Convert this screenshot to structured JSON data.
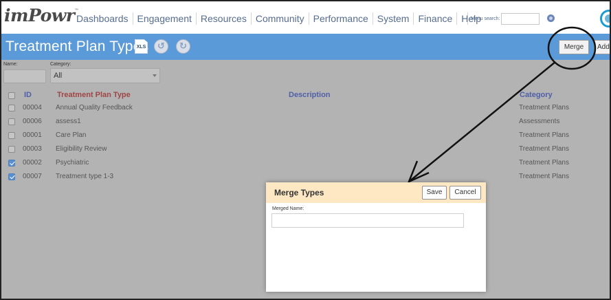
{
  "app": {
    "logo": "imPowr",
    "logo_mark": "™"
  },
  "nav": {
    "items": [
      "Dashboards",
      "Engagement",
      "Resources",
      "Community",
      "Performance",
      "System",
      "Finance",
      "Help"
    ],
    "menu_search_label": "Menu search:",
    "menu_search_value": ""
  },
  "header": {
    "title": "Treatment Plan Types",
    "xls_label": "XLS",
    "merge_label": "Merge",
    "add_label": "Add"
  },
  "filters": {
    "name_label": "Name:",
    "name_value": "",
    "category_label": "Category:",
    "category_value": "All"
  },
  "table": {
    "columns": {
      "id": "ID",
      "type": "Treatment Plan Type",
      "description": "Description",
      "category": "Category"
    },
    "rows": [
      {
        "id": "00004",
        "type": "Annual Quality Feedback",
        "description": "",
        "category": "Treatment Plans",
        "checked": false
      },
      {
        "id": "00006",
        "type": "assess1",
        "description": "",
        "category": "Assessments",
        "checked": false
      },
      {
        "id": "00001",
        "type": "Care Plan",
        "description": "",
        "category": "Treatment Plans",
        "checked": false
      },
      {
        "id": "00003",
        "type": "Eligibility Review",
        "description": "",
        "category": "Treatment Plans",
        "checked": false
      },
      {
        "id": "00002",
        "type": "Psychiatric",
        "description": "",
        "category": "Treatment Plans",
        "checked": true
      },
      {
        "id": "00007",
        "type": "Treatment type 1-3",
        "description": "",
        "category": "Treatment Plans",
        "checked": true
      }
    ]
  },
  "dialog": {
    "title": "Merge Types",
    "save_label": "Save",
    "cancel_label": "Cancel",
    "merged_name_label": "Merged Name:",
    "merged_name_value": ""
  },
  "colors": {
    "header_blue": "#5b9ad8",
    "nav_text": "#566d8f",
    "type_header": "#a04545",
    "desc_header": "#4f5fa8",
    "category_header": "#4f5fa8",
    "dialog_header": "#fde8c3",
    "checkbox_on": "#5a8fd0"
  },
  "icons": [
    "xls-file-icon",
    "undo-icon",
    "redo-icon",
    "help-icon",
    "user-avatar-icon",
    "chevron-down-icon",
    "annotation-circle",
    "annotation-arrow"
  ]
}
